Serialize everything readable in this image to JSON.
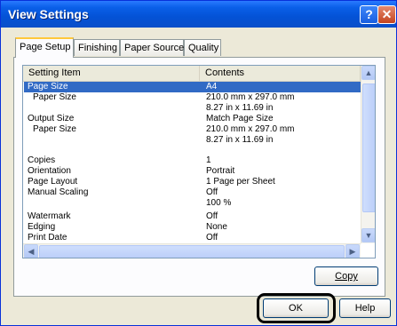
{
  "window": {
    "title": "View Settings",
    "help_glyph": "?",
    "close_glyph": "✕"
  },
  "tabs": [
    {
      "label": "Page Setup",
      "active": true
    },
    {
      "label": "Finishing",
      "active": false
    },
    {
      "label": "Paper Source",
      "active": false
    },
    {
      "label": "Quality",
      "active": false
    }
  ],
  "table": {
    "columns": [
      "Setting Item",
      "Contents"
    ],
    "rows": [
      {
        "item": "Page Size",
        "value": "A4",
        "selected": true
      },
      {
        "item": "Paper Size",
        "value": "210.0 mm x 297.0 mm"
      },
      {
        "item": "",
        "value": "8.27 in x 11.69 in"
      },
      {
        "item": "Output Size",
        "value": "Match Page Size"
      },
      {
        "item": "Paper Size",
        "value": "210.0 mm x 297.0 mm"
      },
      {
        "item": "",
        "value": "8.27 in x 11.69 in"
      },
      {
        "item": "Copies",
        "value": "1"
      },
      {
        "item": "Orientation",
        "value": "Portrait"
      },
      {
        "item": "Page Layout",
        "value": "1 Page per Sheet"
      },
      {
        "item": "Manual Scaling",
        "value": "Off"
      },
      {
        "item": "",
        "value": "100 %"
      },
      {
        "item": "Watermark",
        "value": "Off"
      },
      {
        "item": "Edging",
        "value": "None"
      },
      {
        "item": "Print Date",
        "value": "Off"
      }
    ]
  },
  "buttons": {
    "copy": "Copy",
    "ok": "OK",
    "help": "Help"
  },
  "colors": {
    "selection": "#316ac5",
    "titlebar": "#0452d6",
    "highlight_ring": "#000000"
  }
}
